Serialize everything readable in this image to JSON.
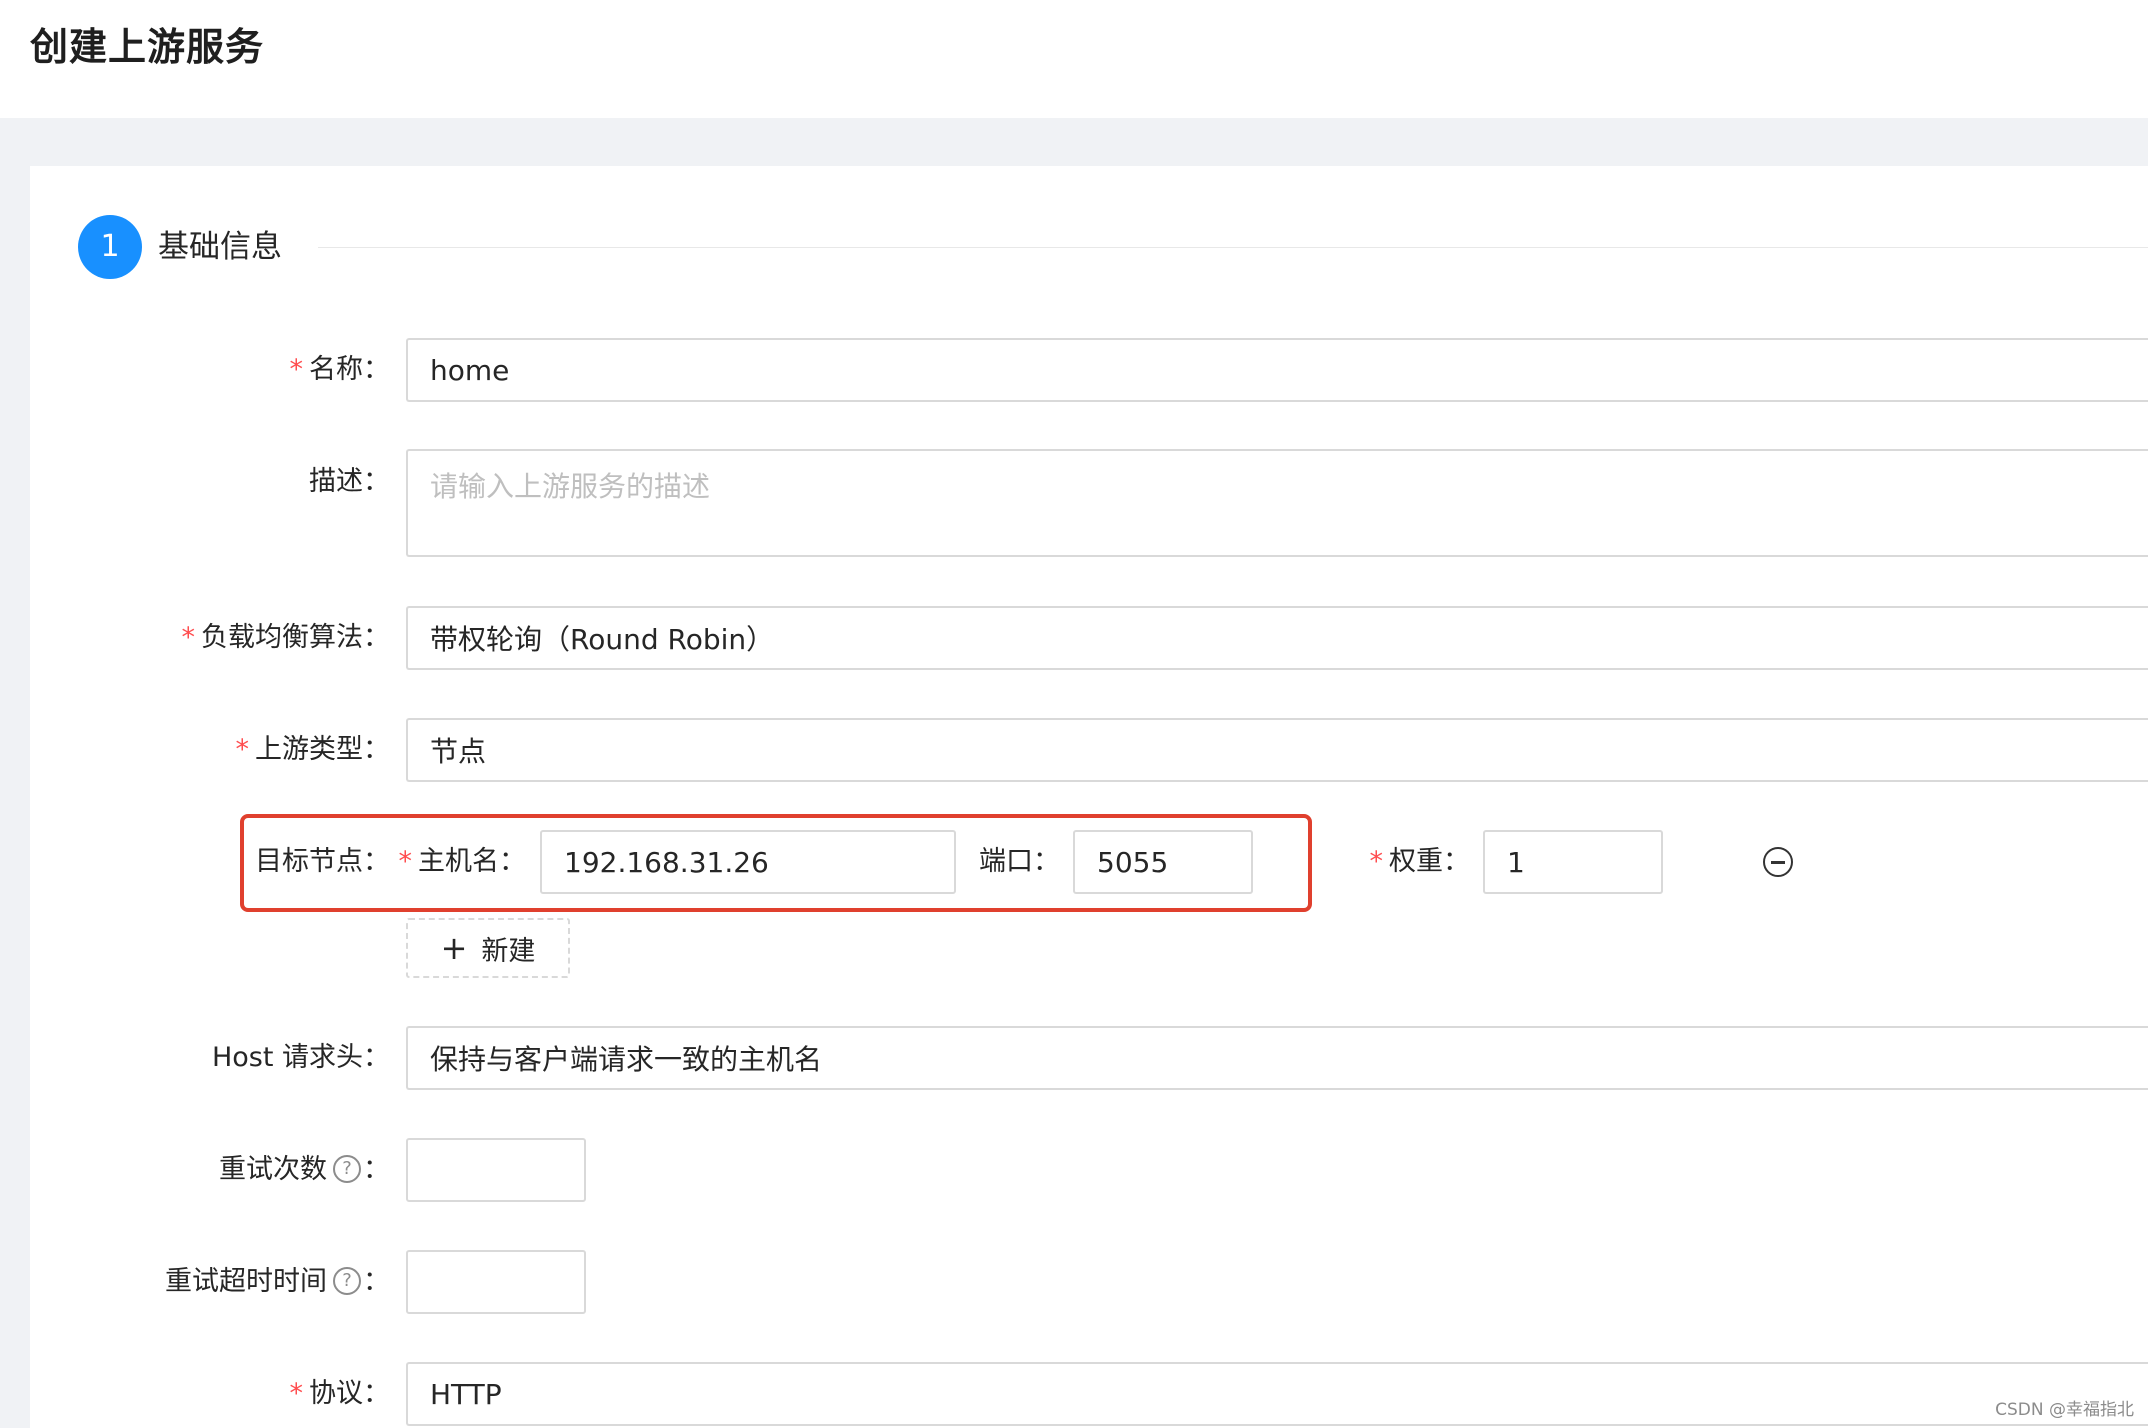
{
  "page": {
    "title": "创建上游服务"
  },
  "step": {
    "number": "1",
    "title": "基础信息"
  },
  "form": {
    "required_mark": "*",
    "name": {
      "label": "名称：",
      "value": "home"
    },
    "description": {
      "label": "描述：",
      "placeholder": "请输入上游服务的描述"
    },
    "algorithm": {
      "label": "负载均衡算法：",
      "value": "带权轮询（Round Robin）"
    },
    "upstream_type": {
      "label": "上游类型：",
      "value": "节点"
    },
    "target_nodes": {
      "label": "目标节点：",
      "host_label": "主机名：",
      "host_value": "192.168.31.26",
      "port_label": "端口：",
      "port_value": "5055",
      "weight_label": "权重：",
      "weight_value": "1",
      "add_label": "新建"
    },
    "host_header": {
      "label": "Host 请求头：",
      "value": "保持与客户端请求一致的主机名"
    },
    "retries": {
      "label": "重试次数",
      "value": ""
    },
    "retry_timeout": {
      "label": "重试超时时间",
      "value": ""
    },
    "protocol": {
      "label": "协议：",
      "value": "HTTP"
    },
    "help_glyph": "?",
    "colon": "："
  },
  "watermark": "CSDN @幸福指北",
  "colors": {
    "primary": "#1890ff",
    "required": "#ff4d4f",
    "highlight": "#e0402e",
    "border": "#d9d9d9",
    "background": "#f0f2f5"
  },
  "icons": {
    "remove": "minus-circle-icon",
    "add": "plus-icon",
    "help": "question-circle-icon"
  }
}
